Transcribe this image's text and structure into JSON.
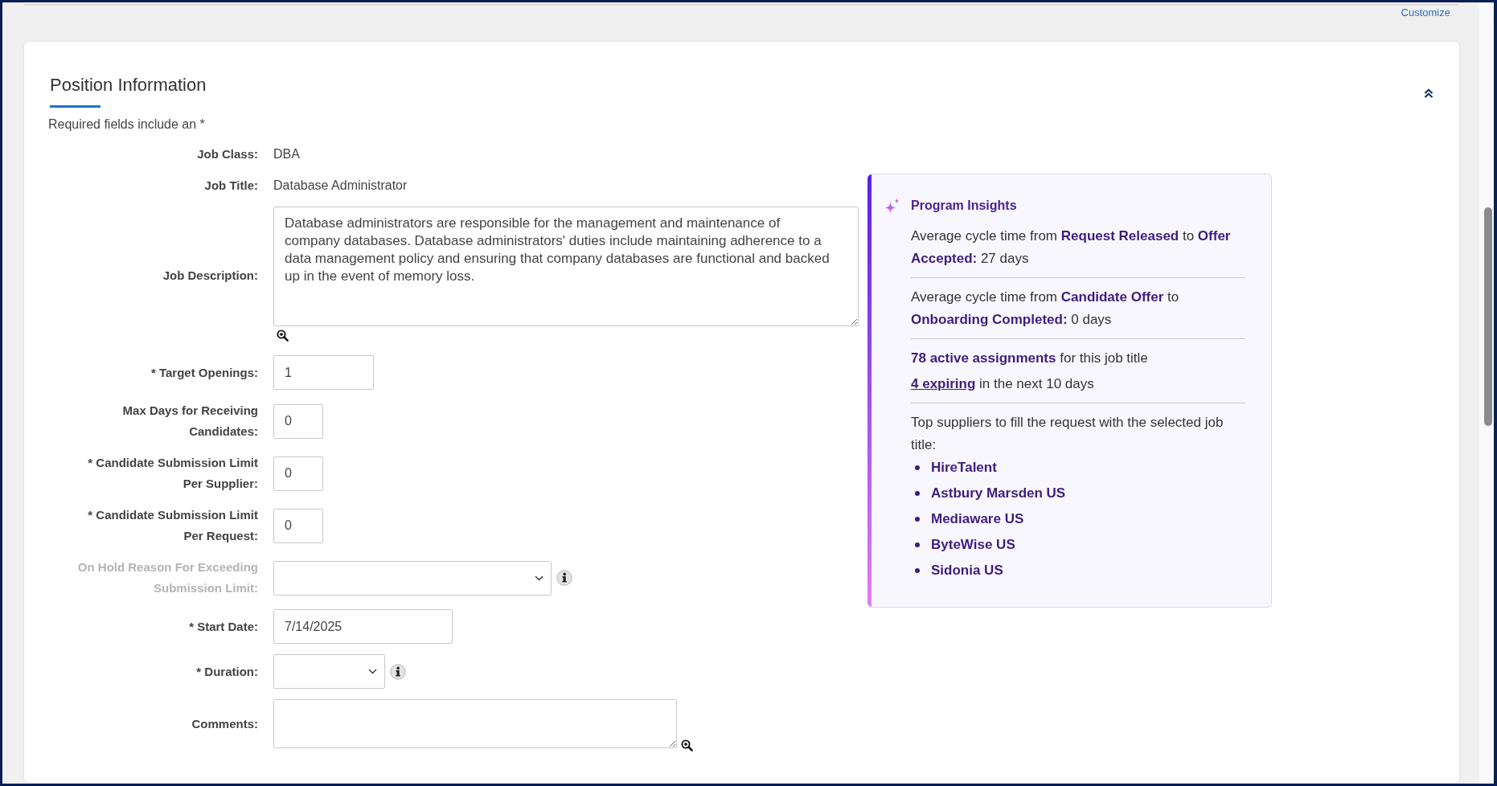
{
  "toolbar": {
    "customize_link": "Customize"
  },
  "section": {
    "title": "Position Information",
    "expanded": true,
    "required_note": "Required fields include an *"
  },
  "fields": [
    {
      "kind": "static",
      "label": "Job Class:",
      "value": "DBA",
      "disabled": false
    },
    {
      "kind": "static",
      "label": "Job Title:",
      "value": "Database Administrator",
      "disabled": false
    },
    {
      "kind": "textarea",
      "label": "Job Description:",
      "value": "Database administrators are responsible for the management and maintenance of company databases. Database administrators' duties include maintaining adherence to a data management policy and ensuring that company databases are functional and backed up in the event of memory loss.",
      "zoom_icon": true,
      "disabled": false
    },
    {
      "kind": "input",
      "label": "* Target Openings:",
      "value": "1",
      "disabled": false
    },
    {
      "kind": "input",
      "label": "Max Days for Receiving Candidates:",
      "value": "0",
      "disabled": false
    },
    {
      "kind": "input",
      "label": "* Candidate Submission Limit Per Supplier:",
      "value": "0",
      "disabled": false
    },
    {
      "kind": "input",
      "label": "* Candidate Submission Limit Per Request:",
      "value": "0",
      "disabled": false
    },
    {
      "kind": "select",
      "label": "On Hold Reason For Exceeding Submission Limit:",
      "info_icon": true,
      "disabled": true
    },
    {
      "kind": "input",
      "label": "* Start Date:",
      "value": "7/14/2025",
      "disabled": false
    },
    {
      "kind": "select",
      "label": "* Duration:",
      "info_icon": true,
      "disabled": false
    },
    {
      "kind": "textarea",
      "label": "Comments:",
      "zoom_icon": true,
      "disabled": false
    }
  ],
  "insights": {
    "title": "Program Insights",
    "groups": [
      {
        "paragraphs": [
          {
            "kind": "text",
            "text": "Average cycle time from **Request Released** to **Offer Accepted:** 27 days"
          }
        ]
      },
      {
        "paragraphs": [
          {
            "kind": "text",
            "text": "Average cycle time from **Candidate Offer** to **Onboarding Completed:** 0 days"
          }
        ]
      },
      {
        "paragraphs": [
          {
            "kind": "text",
            "text": "**78 active assignments** for this job title"
          },
          {
            "kind": "link",
            "link": "4 expiring",
            "text": "in the next 10 days"
          }
        ]
      },
      {
        "paragraphs": [
          {
            "kind": "list",
            "text": "Top suppliers to fill the request with the selected job title:",
            "items": [
              "HireTalent",
              "Astbury Marsden US",
              "Mediaware US",
              "ByteWise US",
              "Sidonia US"
            ]
          }
        ]
      }
    ]
  }
}
